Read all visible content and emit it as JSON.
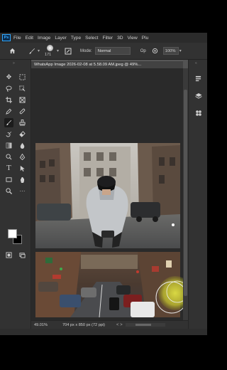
{
  "menubar": {
    "logo": "Ps",
    "items": [
      "File",
      "Edit",
      "Image",
      "Layer",
      "Type",
      "Select",
      "Filter",
      "3D",
      "View",
      "Plu"
    ]
  },
  "options": {
    "brush_size": "171",
    "mode_label": "Mode:",
    "mode_value": "Normal",
    "opacity_label": "Op",
    "flow_value": "100%"
  },
  "document": {
    "tab_title": "WhatsApp Image 2026-02-08 at 5.58.09 AM.jpeg @ 49%...",
    "close": "×"
  },
  "status": {
    "zoom": "49.01%",
    "doc_info": "704 px x 850 px (72 ppi)",
    "arrows": "<  >"
  },
  "colors": {
    "accent": "#31a8ff",
    "foreground": "#ffffff",
    "background": "#000000",
    "brush_cursor": "#d8d83a"
  }
}
